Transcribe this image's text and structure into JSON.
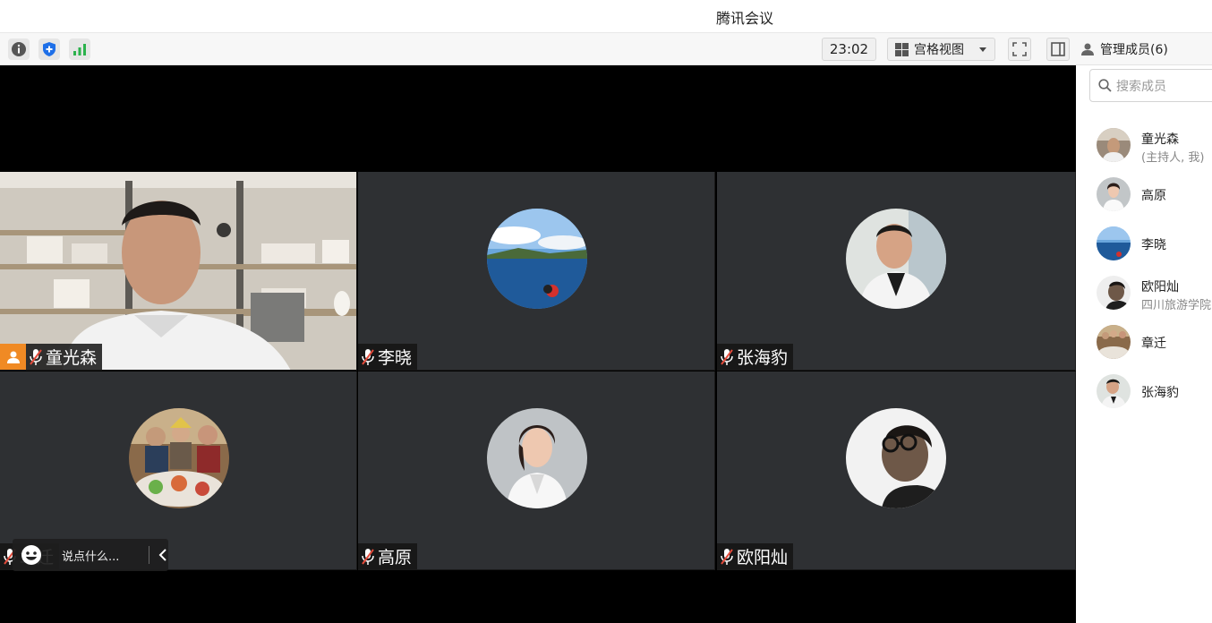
{
  "window": {
    "title": "腾讯会议"
  },
  "toolbar": {
    "info_icon": "info-icon",
    "shield_icon": "shield-icon",
    "signal_icon": "signal-icon",
    "timer": "23:02",
    "view_label": "宫格视图",
    "manage_label": "管理成员(6)"
  },
  "tiles": [
    {
      "name": "童光森",
      "type": "video",
      "host": true
    },
    {
      "name": "李晓",
      "type": "avatar"
    },
    {
      "name": "张海豹",
      "type": "avatar"
    },
    {
      "name": "章迁",
      "type": "avatar"
    },
    {
      "name": "高原",
      "type": "avatar"
    },
    {
      "name": "欧阳灿",
      "type": "avatar"
    }
  ],
  "chat": {
    "placeholder": "说点什么..."
  },
  "panel": {
    "search_placeholder": "搜索成员",
    "members": [
      {
        "name": "童光森",
        "sub": "(主持人, 我)"
      },
      {
        "name": "高原",
        "sub": ""
      },
      {
        "name": "李晓",
        "sub": ""
      },
      {
        "name": "欧阳灿",
        "sub": "四川旅游学院"
      },
      {
        "name": "章迁",
        "sub": ""
      },
      {
        "name": "张海豹",
        "sub": ""
      }
    ]
  },
  "colors": {
    "host_badge": "#f08a24",
    "tile_bg": "#2e3033",
    "accent_blue": "#1e6fe8",
    "signal_green": "#2bb24c"
  }
}
